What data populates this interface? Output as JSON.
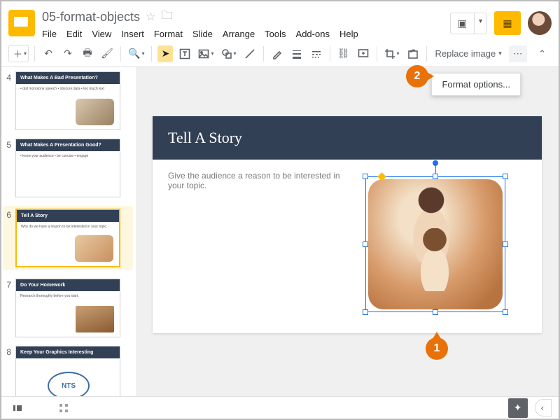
{
  "header": {
    "doc_title": "05-format-objects",
    "menus": [
      "File",
      "Edit",
      "View",
      "Insert",
      "Format",
      "Slide",
      "Arrange",
      "Tools",
      "Add-ons",
      "Help"
    ]
  },
  "toolbar": {
    "replace_image_label": "Replace image"
  },
  "popup": {
    "format_options": "Format options..."
  },
  "filmstrip": [
    {
      "n": "4",
      "title": "What Makes A Bad Presentation?",
      "body": "• dull monotone speech\n• obscure data\n• too much text"
    },
    {
      "n": "5",
      "title": "What Makes A Presentation Good?",
      "body": "• know your audience\n• be concise\n• engage"
    },
    {
      "n": "6",
      "title": "Tell A Story",
      "body": "Why do we have a reason to be interested in your topic.",
      "selected": true
    },
    {
      "n": "7",
      "title": "Do Your Homework",
      "body": "Research thoroughly before you start."
    },
    {
      "n": "8",
      "title": "Keep Your Graphics Interesting",
      "body": ""
    }
  ],
  "main_slide": {
    "title": "Tell A Story",
    "body": "Give the audience a reason to be interested in your topic."
  },
  "callouts": {
    "one": "1",
    "two": "2"
  }
}
